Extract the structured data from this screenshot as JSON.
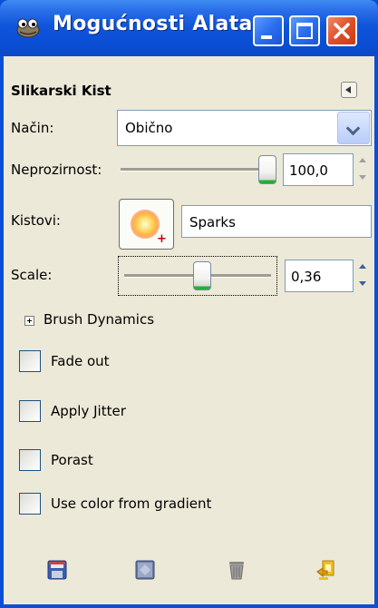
{
  "window": {
    "title": "Mogućnosti Alata",
    "icon": "gimp-wilber-icon",
    "controls": {
      "minimize": "minimize-icon",
      "maximize": "maximize-icon",
      "close": "close-icon"
    }
  },
  "panel": {
    "heading": "Slikarski Kist",
    "menu_icon": "tab-menu-arrow-icon"
  },
  "mode": {
    "label": "Način:",
    "value": "Obično"
  },
  "opacity": {
    "label": "Neprozirnost:",
    "value": "100,0",
    "fraction": 1.0
  },
  "brushes": {
    "label": "Kistovi:",
    "name": "Sparks",
    "preview_icon": "sparks-brush-icon"
  },
  "scale": {
    "label": "Scale:",
    "value": "0,36",
    "fraction": 0.5
  },
  "brush_dynamics": {
    "label": "Brush Dynamics",
    "expanded": false
  },
  "checkboxes": [
    {
      "label": "Fade out",
      "checked": false
    },
    {
      "label": "Apply Jitter",
      "checked": false
    },
    {
      "label": "Porast",
      "checked": false
    },
    {
      "label": "Use color from gradient",
      "checked": false
    }
  ],
  "bottom_toolbar": [
    "save-options-icon",
    "restore-options-icon",
    "delete-options-icon",
    "reset-options-icon"
  ],
  "colors": {
    "titlebar": "#0a4fd6",
    "background": "#ece9d8",
    "close_button": "#e0502a",
    "slider_accent": "#21b03a"
  }
}
